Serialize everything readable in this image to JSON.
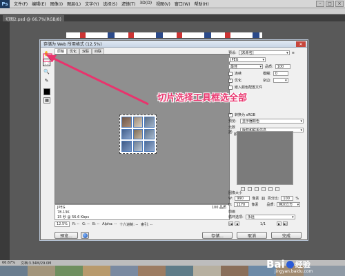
{
  "photoshop": {
    "logo": "Ps",
    "menus": [
      "文件(F)",
      "编辑(E)",
      "图像(I)",
      "图层(L)",
      "文字(Y)",
      "选择(S)",
      "滤镜(T)",
      "3D(D)",
      "视图(V)",
      "窗口(W)",
      "帮助(H)"
    ],
    "doc_tab": "切图2.psd @ 66.7%(RGB/8)",
    "status_zoom": "66.67%",
    "status_doc": "文档:3.34M/29.0M"
  },
  "dialog": {
    "title": "存储为 Web 所用格式 (12.5%)",
    "view_tabs": [
      "原稿",
      "优化",
      "双联",
      "四联"
    ],
    "preview_info": {
      "format": "JPEG",
      "size": "78.13K",
      "speed": "15 秒 @ 56.6 Kbps",
      "quality": "100 品质"
    },
    "zoom": "12.5%",
    "readouts": [
      "R: --",
      "G: --",
      "B: --",
      "Alpha: --",
      "十六进制: --",
      "索引: --"
    ],
    "buttons": {
      "preview": "预览...",
      "save": "存储...",
      "cancel": "取消",
      "done": "完成"
    }
  },
  "settings": {
    "preset_label": "预设:",
    "preset_value": "[未命名]",
    "format": "JPEG",
    "quality_preset": "最佳",
    "quality_label": "品质:",
    "quality_value": "100",
    "progressive_label": "连续",
    "blur_label": "模糊:",
    "blur_value": "0",
    "optimized_label": "优化",
    "optimized_checked": "✓",
    "matte_label": "杂边:",
    "icc_label": "嵌入颜色配置文件",
    "convert_srgb_label": "转换为 sRGB",
    "convert_srgb_checked": "✓",
    "preview_label": "预览:",
    "preview_value": "显示器颜色",
    "metadata_label": "元数据:",
    "metadata_value": "版权和联系信息",
    "color_table_label": "颜色表",
    "image_size_label": "图像大小",
    "width_label": "W:",
    "width_value": "990",
    "height_label": "H:",
    "height_value": "1170",
    "unit": "像素",
    "percent_label": "百分比:",
    "percent_value": "100",
    "percent_unit": "%",
    "quality_resample_label": "品质:",
    "quality_resample_value": "两次立方",
    "animation_label": "动画",
    "loop_label": "循环选项:",
    "loop_value": "永远",
    "frame_counter": "1/1"
  },
  "annotation": {
    "text": "切片选择工具框选全部",
    "color": "#e8346d"
  },
  "watermark": {
    "brand": "Bai",
    "brand2": "经验",
    "url": "jingyan.baidu.com"
  }
}
